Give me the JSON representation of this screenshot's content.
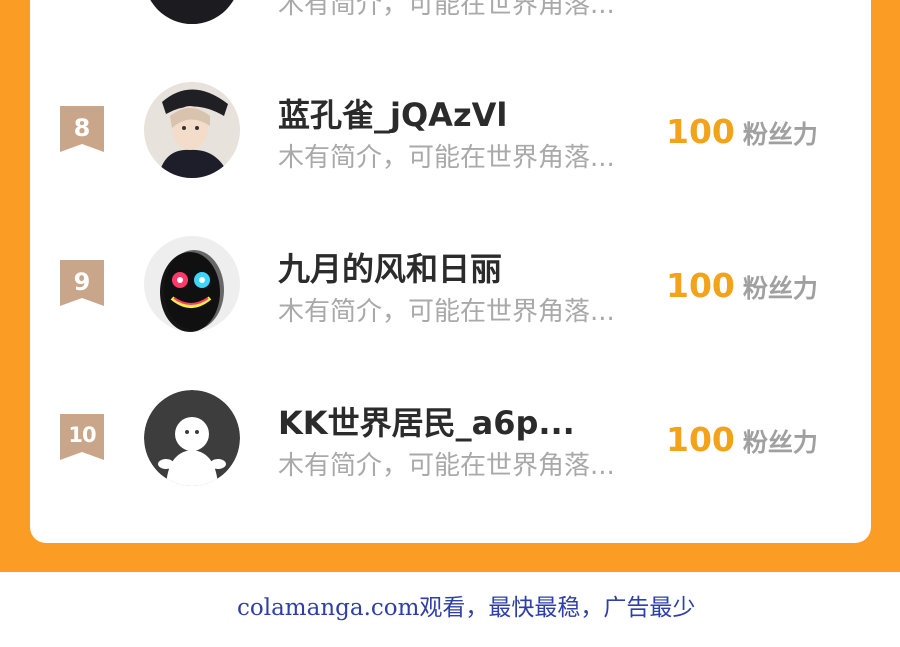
{
  "rankings": [
    {
      "rank": "",
      "name": "",
      "bio": "木有简介，可能在世界角落...",
      "fans": "",
      "fans_label": "",
      "avatar": "dark-avatar-partial"
    },
    {
      "rank": "8",
      "name": "蓝孔雀_jQAzVl",
      "bio": "木有简介，可能在世界角落...",
      "fans": "100",
      "fans_label": "粉丝力",
      "avatar": "photo-avatar-person"
    },
    {
      "rank": "9",
      "name": "九月的风和日丽",
      "bio": "木有简介，可能在世界角落...",
      "fans": "100",
      "fans_label": "粉丝力",
      "avatar": "glitch-smiley-avatar"
    },
    {
      "rank": "10",
      "name": "KK世界居民_a6p...",
      "bio": "木有简介，可能在世界角落...",
      "fans": "100",
      "fans_label": "粉丝力",
      "avatar": "default-ghost-avatar"
    }
  ],
  "footer": {
    "watermark": "colamanga.com观看，最快最稳，广告最少"
  },
  "colors": {
    "panel": "#fb9c24",
    "card": "#ffffff",
    "rank_badge": "#c9a68a",
    "fans_number": "#f2a31a",
    "fans_label": "#a0a0a0",
    "name": "#2b2b2b",
    "bio": "#a9a9a9",
    "watermark": "#2f3fa8"
  }
}
